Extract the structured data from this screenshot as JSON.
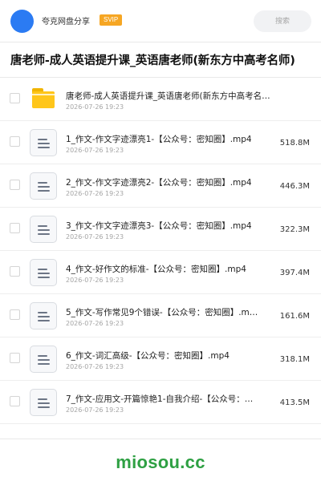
{
  "header": {
    "app_name": "夸克网盘分享",
    "badge": "SVIP",
    "search_placeholder": "搜索",
    "avatar_color": "#2b7bf3",
    "badge_color": "#f6a623"
  },
  "page_title": "唐老师-成人英语提升课_英语唐老师(新东方中高考名师)",
  "items": [
    {
      "type": "folder",
      "icon": "folder-icon",
      "name": "唐老师-成人英语提升课_英语唐老师(新东方中高考名…",
      "date": "2026-07-26 19:23",
      "size": ""
    },
    {
      "type": "file",
      "icon": "document-icon",
      "name": "1_作文-作文字迹漂亮1-【公众号：密知圈】.mp4",
      "date": "2026-07-26 19:23",
      "size": "518.8M"
    },
    {
      "type": "file",
      "icon": "document-icon",
      "name": "2_作文-作文字迹漂亮2-【公众号：密知圈】.mp4",
      "date": "2026-07-26 19:23",
      "size": "446.3M"
    },
    {
      "type": "file",
      "icon": "document-icon",
      "name": "3_作文-作文字迹漂亮3-【公众号：密知圈】.mp4",
      "date": "2026-07-26 19:23",
      "size": "322.3M"
    },
    {
      "type": "file",
      "icon": "document-icon",
      "name": "4_作文-好作文的标准-【公众号：密知圈】.mp4",
      "date": "2026-07-26 19:23",
      "size": "397.4M"
    },
    {
      "type": "file",
      "icon": "document-icon",
      "name": "5_作文-写作常见9个错误-【公众号：密知圈】.m…",
      "date": "2026-07-26 19:23",
      "size": "161.6M"
    },
    {
      "type": "file",
      "icon": "document-icon",
      "name": "6_作文-词汇高级-【公众号：密知圈】.mp4",
      "date": "2026-07-26 19:23",
      "size": "318.1M"
    },
    {
      "type": "file",
      "icon": "document-icon",
      "name": "7_作文-应用文-开篇惊艳1-自我介绍-【公众号：…",
      "date": "2026-07-26 19:23",
      "size": "413.5M"
    }
  ],
  "watermark": "miosou.cc",
  "watermark_color": "#2ea043"
}
